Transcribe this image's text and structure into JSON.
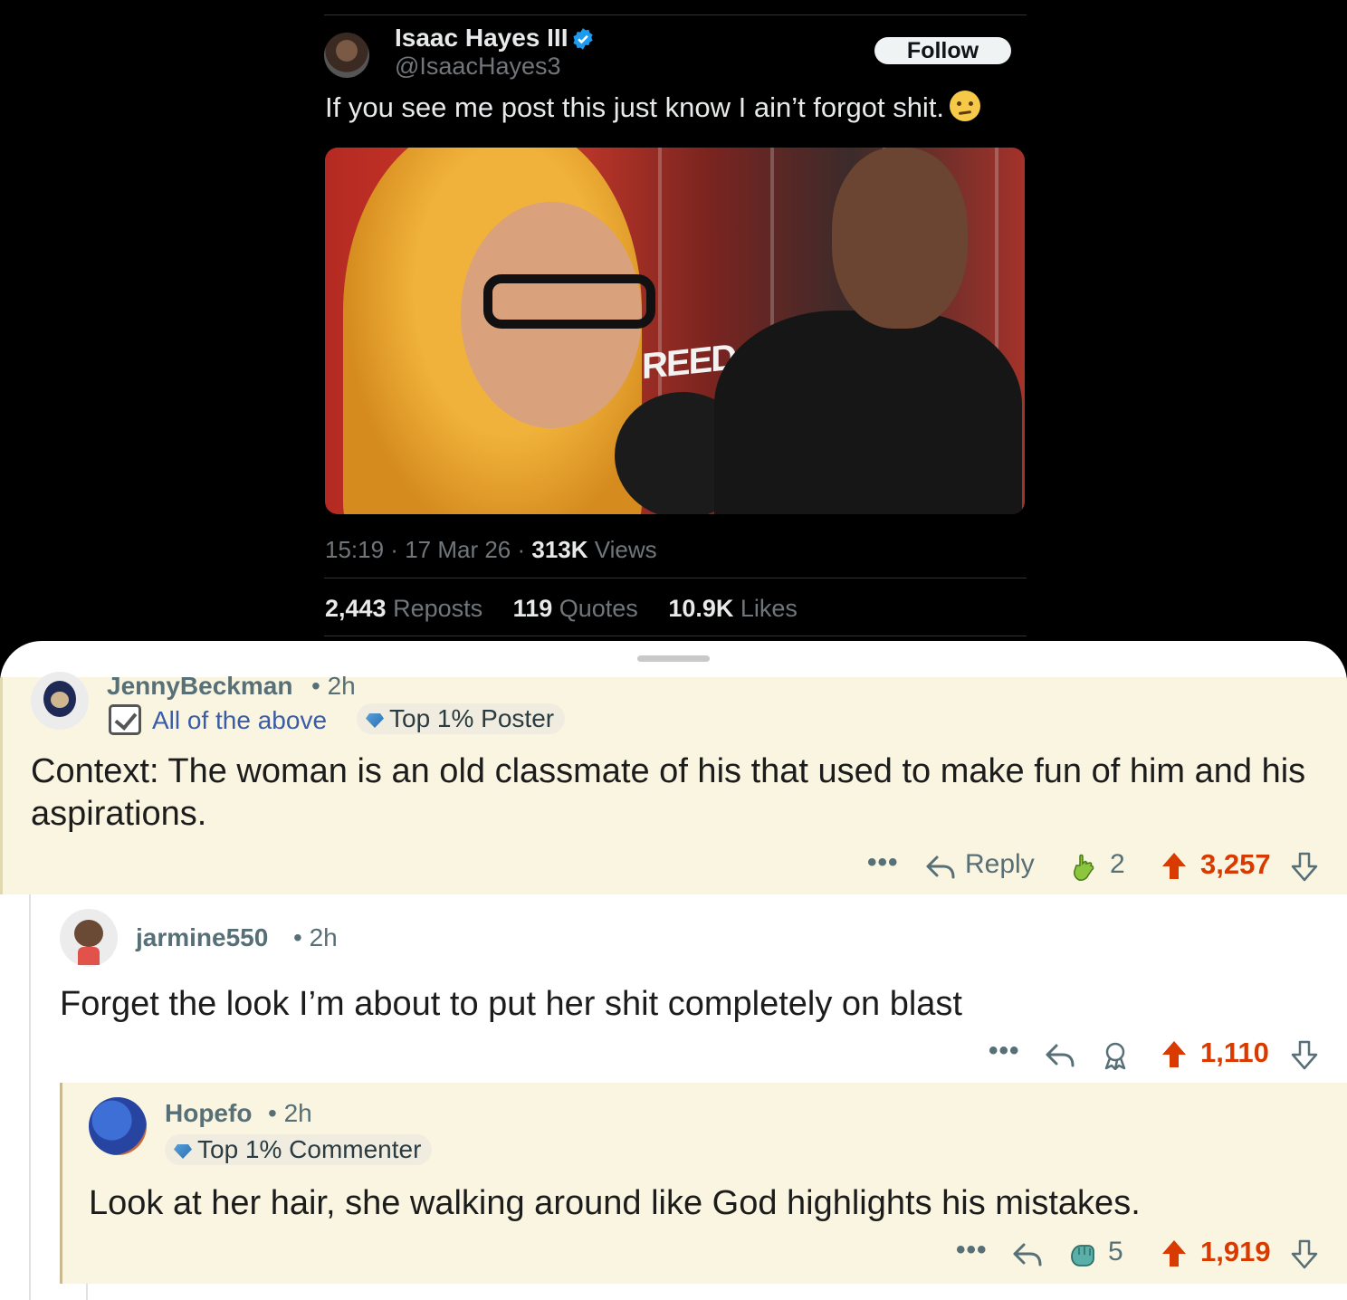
{
  "tweet": {
    "author_name": "Isaac Hayes III",
    "author_handle": "@IsaacHayes3",
    "follow_label": "Follow",
    "text": "If you see me post this just know I ain’t forgot shit.",
    "emoji_icon": "raised-eyebrow-emoji",
    "media_sign_text": "REED",
    "time": "15:19",
    "date": "17 Mar 26",
    "views_value": "313K",
    "views_label": "Views",
    "reposts_value": "2,443",
    "reposts_label": "Reposts",
    "quotes_value": "119",
    "quotes_label": "Quotes",
    "likes_value": "10.9K",
    "likes_label": "Likes"
  },
  "comments": [
    {
      "username": "JennyBeckman",
      "time": "2h",
      "flair": "All of the above",
      "badge": "Top 1% Poster",
      "body": "Context: The woman is an old classmate of his that used to make fun of him and his aspirations.",
      "more": "•••",
      "reply_label": "Reply",
      "award_count": "2",
      "score": "3,257"
    },
    {
      "username": "jarmine550",
      "time": "2h",
      "body": "Forget the look I’m about to put her shit completely on blast",
      "more": "•••",
      "score": "1,110"
    },
    {
      "username": "Hopefo",
      "time": "2h",
      "badge": "Top 1% Commenter",
      "body": "Look at her hair, she walking around like God highlights his mistakes.",
      "more": "•••",
      "award_count": "5",
      "score": "1,919"
    }
  ],
  "colors": {
    "highlight_bg": "#faf5e0",
    "upvote": "#d93a00",
    "verified": "#1d9bf0",
    "meta_gray": "#576f76"
  }
}
